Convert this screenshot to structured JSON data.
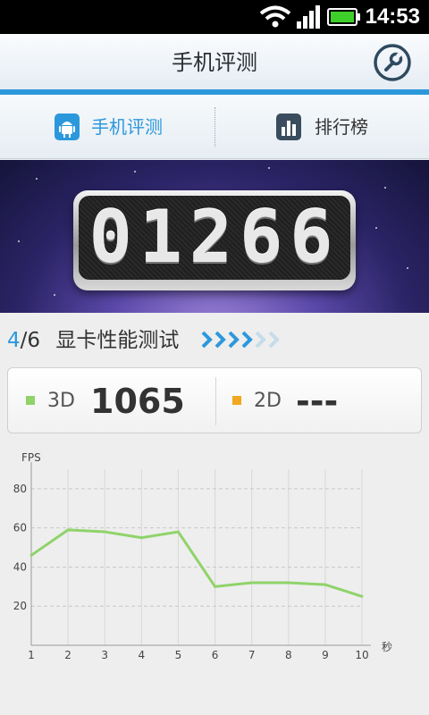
{
  "status_bar": {
    "time": "14:53"
  },
  "header": {
    "title": "手机评测"
  },
  "tabs": [
    {
      "label": "手机评测",
      "active": true,
      "icon": "android-icon"
    },
    {
      "label": "排行榜",
      "active": false,
      "icon": "bar-chart-icon"
    }
  ],
  "score": {
    "total": "01266"
  },
  "test": {
    "current": "4",
    "total_text": "/6",
    "name": "显卡性能测试",
    "progress_steps_done": 4,
    "progress_steps_total": 6
  },
  "results": {
    "d3": {
      "label": "3D",
      "value": "1065",
      "color": "#8fd36a"
    },
    "d2": {
      "label": "2D",
      "value": "---",
      "color": "#f0a820"
    }
  },
  "colors": {
    "accent": "#2c98dc",
    "line": "#8fd36a"
  },
  "chart_data": {
    "type": "line",
    "ylabel": "FPS",
    "xlabel": "秒",
    "x": [
      1,
      2,
      3,
      4,
      5,
      6,
      7,
      8,
      9,
      10
    ],
    "series": [
      {
        "values": [
          46,
          59,
          58,
          55,
          58,
          30,
          32,
          32,
          31,
          25
        ]
      }
    ],
    "xlim": [
      1,
      10
    ],
    "ylim": [
      0,
      90
    ],
    "yticks": [
      20,
      40,
      60,
      80
    ],
    "grid": true
  }
}
